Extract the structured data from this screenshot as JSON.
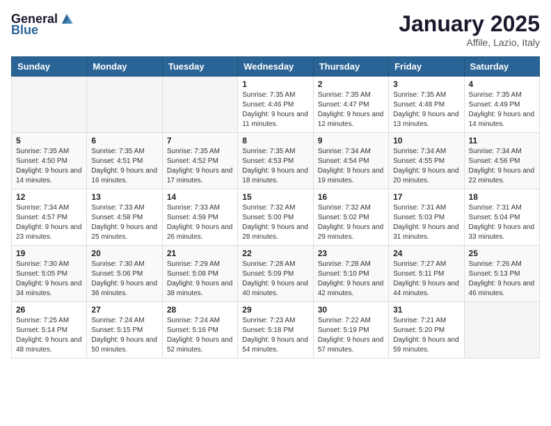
{
  "header": {
    "logo_general": "General",
    "logo_blue": "Blue",
    "month_title": "January 2025",
    "location": "Affile, Lazio, Italy"
  },
  "weekdays": [
    "Sunday",
    "Monday",
    "Tuesday",
    "Wednesday",
    "Thursday",
    "Friday",
    "Saturday"
  ],
  "weeks": [
    [
      {
        "day": "",
        "sunrise": "",
        "sunset": "",
        "daylight": ""
      },
      {
        "day": "",
        "sunrise": "",
        "sunset": "",
        "daylight": ""
      },
      {
        "day": "",
        "sunrise": "",
        "sunset": "",
        "daylight": ""
      },
      {
        "day": "1",
        "sunrise": "Sunrise: 7:35 AM",
        "sunset": "Sunset: 4:46 PM",
        "daylight": "Daylight: 9 hours and 11 minutes."
      },
      {
        "day": "2",
        "sunrise": "Sunrise: 7:35 AM",
        "sunset": "Sunset: 4:47 PM",
        "daylight": "Daylight: 9 hours and 12 minutes."
      },
      {
        "day": "3",
        "sunrise": "Sunrise: 7:35 AM",
        "sunset": "Sunset: 4:48 PM",
        "daylight": "Daylight: 9 hours and 13 minutes."
      },
      {
        "day": "4",
        "sunrise": "Sunrise: 7:35 AM",
        "sunset": "Sunset: 4:49 PM",
        "daylight": "Daylight: 9 hours and 14 minutes."
      }
    ],
    [
      {
        "day": "5",
        "sunrise": "Sunrise: 7:35 AM",
        "sunset": "Sunset: 4:50 PM",
        "daylight": "Daylight: 9 hours and 14 minutes."
      },
      {
        "day": "6",
        "sunrise": "Sunrise: 7:35 AM",
        "sunset": "Sunset: 4:51 PM",
        "daylight": "Daylight: 9 hours and 16 minutes."
      },
      {
        "day": "7",
        "sunrise": "Sunrise: 7:35 AM",
        "sunset": "Sunset: 4:52 PM",
        "daylight": "Daylight: 9 hours and 17 minutes."
      },
      {
        "day": "8",
        "sunrise": "Sunrise: 7:35 AM",
        "sunset": "Sunset: 4:53 PM",
        "daylight": "Daylight: 9 hours and 18 minutes."
      },
      {
        "day": "9",
        "sunrise": "Sunrise: 7:34 AM",
        "sunset": "Sunset: 4:54 PM",
        "daylight": "Daylight: 9 hours and 19 minutes."
      },
      {
        "day": "10",
        "sunrise": "Sunrise: 7:34 AM",
        "sunset": "Sunset: 4:55 PM",
        "daylight": "Daylight: 9 hours and 20 minutes."
      },
      {
        "day": "11",
        "sunrise": "Sunrise: 7:34 AM",
        "sunset": "Sunset: 4:56 PM",
        "daylight": "Daylight: 9 hours and 22 minutes."
      }
    ],
    [
      {
        "day": "12",
        "sunrise": "Sunrise: 7:34 AM",
        "sunset": "Sunset: 4:57 PM",
        "daylight": "Daylight: 9 hours and 23 minutes."
      },
      {
        "day": "13",
        "sunrise": "Sunrise: 7:33 AM",
        "sunset": "Sunset: 4:58 PM",
        "daylight": "Daylight: 9 hours and 25 minutes."
      },
      {
        "day": "14",
        "sunrise": "Sunrise: 7:33 AM",
        "sunset": "Sunset: 4:59 PM",
        "daylight": "Daylight: 9 hours and 26 minutes."
      },
      {
        "day": "15",
        "sunrise": "Sunrise: 7:32 AM",
        "sunset": "Sunset: 5:00 PM",
        "daylight": "Daylight: 9 hours and 28 minutes."
      },
      {
        "day": "16",
        "sunrise": "Sunrise: 7:32 AM",
        "sunset": "Sunset: 5:02 PM",
        "daylight": "Daylight: 9 hours and 29 minutes."
      },
      {
        "day": "17",
        "sunrise": "Sunrise: 7:31 AM",
        "sunset": "Sunset: 5:03 PM",
        "daylight": "Daylight: 9 hours and 31 minutes."
      },
      {
        "day": "18",
        "sunrise": "Sunrise: 7:31 AM",
        "sunset": "Sunset: 5:04 PM",
        "daylight": "Daylight: 9 hours and 33 minutes."
      }
    ],
    [
      {
        "day": "19",
        "sunrise": "Sunrise: 7:30 AM",
        "sunset": "Sunset: 5:05 PM",
        "daylight": "Daylight: 9 hours and 34 minutes."
      },
      {
        "day": "20",
        "sunrise": "Sunrise: 7:30 AM",
        "sunset": "Sunset: 5:06 PM",
        "daylight": "Daylight: 9 hours and 36 minutes."
      },
      {
        "day": "21",
        "sunrise": "Sunrise: 7:29 AM",
        "sunset": "Sunset: 5:08 PM",
        "daylight": "Daylight: 9 hours and 38 minutes."
      },
      {
        "day": "22",
        "sunrise": "Sunrise: 7:28 AM",
        "sunset": "Sunset: 5:09 PM",
        "daylight": "Daylight: 9 hours and 40 minutes."
      },
      {
        "day": "23",
        "sunrise": "Sunrise: 7:28 AM",
        "sunset": "Sunset: 5:10 PM",
        "daylight": "Daylight: 9 hours and 42 minutes."
      },
      {
        "day": "24",
        "sunrise": "Sunrise: 7:27 AM",
        "sunset": "Sunset: 5:11 PM",
        "daylight": "Daylight: 9 hours and 44 minutes."
      },
      {
        "day": "25",
        "sunrise": "Sunrise: 7:26 AM",
        "sunset": "Sunset: 5:13 PM",
        "daylight": "Daylight: 9 hours and 46 minutes."
      }
    ],
    [
      {
        "day": "26",
        "sunrise": "Sunrise: 7:25 AM",
        "sunset": "Sunset: 5:14 PM",
        "daylight": "Daylight: 9 hours and 48 minutes."
      },
      {
        "day": "27",
        "sunrise": "Sunrise: 7:24 AM",
        "sunset": "Sunset: 5:15 PM",
        "daylight": "Daylight: 9 hours and 50 minutes."
      },
      {
        "day": "28",
        "sunrise": "Sunrise: 7:24 AM",
        "sunset": "Sunset: 5:16 PM",
        "daylight": "Daylight: 9 hours and 52 minutes."
      },
      {
        "day": "29",
        "sunrise": "Sunrise: 7:23 AM",
        "sunset": "Sunset: 5:18 PM",
        "daylight": "Daylight: 9 hours and 54 minutes."
      },
      {
        "day": "30",
        "sunrise": "Sunrise: 7:22 AM",
        "sunset": "Sunset: 5:19 PM",
        "daylight": "Daylight: 9 hours and 57 minutes."
      },
      {
        "day": "31",
        "sunrise": "Sunrise: 7:21 AM",
        "sunset": "Sunset: 5:20 PM",
        "daylight": "Daylight: 9 hours and 59 minutes."
      },
      {
        "day": "",
        "sunrise": "",
        "sunset": "",
        "daylight": ""
      }
    ]
  ]
}
